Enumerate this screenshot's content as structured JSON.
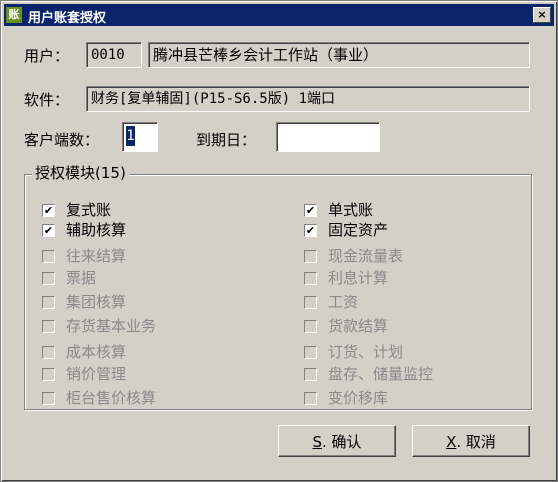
{
  "window": {
    "title": "用户账套授权",
    "icon": "app-icon",
    "close_glyph": "×"
  },
  "user": {
    "label": "用户：",
    "code": "0010",
    "name": "腾冲县芒棒乡会计工作站（事业）"
  },
  "software": {
    "label": "软件：",
    "value": "财务[复单辅固](P15-S6.5版) 1端口"
  },
  "clients": {
    "label": "客户端数：",
    "value": "1"
  },
  "expiry": {
    "label": "到期日：",
    "value": ""
  },
  "modules": {
    "title": "授权模块(15)",
    "check_glyph": "✔",
    "left": [
      {
        "label": "复式账",
        "checked": true,
        "enabled": true
      },
      {
        "label": "辅助核算",
        "checked": true,
        "enabled": true
      },
      {
        "label": "往来结算",
        "checked": false,
        "enabled": false
      },
      {
        "label": "票据",
        "checked": false,
        "enabled": false
      },
      {
        "label": "集团核算",
        "checked": false,
        "enabled": false
      },
      {
        "label": "存货基本业务",
        "checked": false,
        "enabled": false
      },
      {
        "label": "成本核算",
        "checked": false,
        "enabled": false
      },
      {
        "label": "销价管理",
        "checked": false,
        "enabled": false
      },
      {
        "label": "柜台售价核算",
        "checked": false,
        "enabled": false
      }
    ],
    "right": [
      {
        "label": "单式账",
        "checked": true,
        "enabled": true
      },
      {
        "label": "固定资产",
        "checked": true,
        "enabled": true
      },
      {
        "label": "现金流量表",
        "checked": false,
        "enabled": false
      },
      {
        "label": "利息计算",
        "checked": false,
        "enabled": false
      },
      {
        "label": "工资",
        "checked": false,
        "enabled": false
      },
      {
        "label": "货款结算",
        "checked": false,
        "enabled": false
      },
      {
        "label": "订货、计划",
        "checked": false,
        "enabled": false
      },
      {
        "label": "盘存、储量监控",
        "checked": false,
        "enabled": false
      },
      {
        "label": "变价移库",
        "checked": false,
        "enabled": false
      }
    ]
  },
  "buttons": {
    "ok": {
      "hotkey": "S",
      "label": ". 确认"
    },
    "cancel": {
      "hotkey": "X",
      "label": ". 取消"
    }
  }
}
